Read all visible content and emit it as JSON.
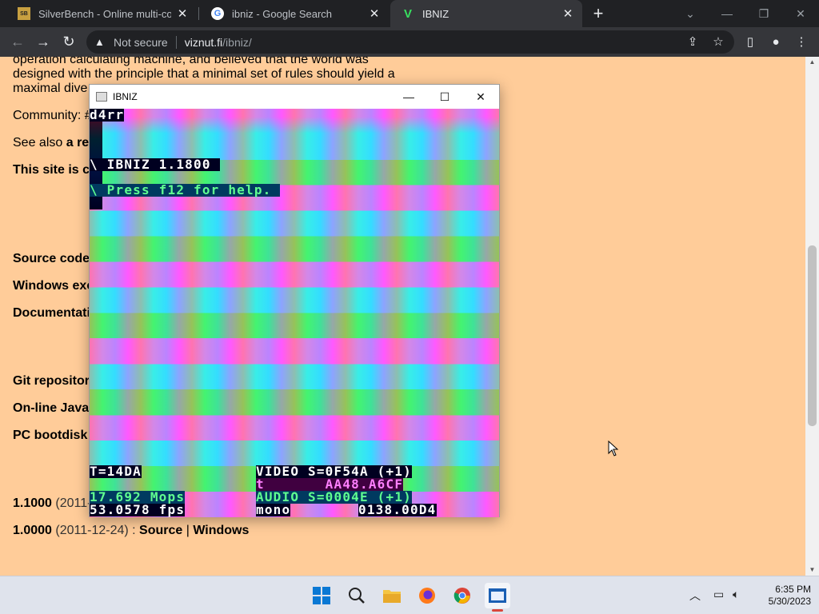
{
  "tabs": [
    {
      "title": "SilverBench - Online multi-core C",
      "favicon": "SB",
      "active": false
    },
    {
      "title": "ibniz - Google Search",
      "favicon": "G",
      "active": false
    },
    {
      "title": "IBNIZ",
      "favicon": "V",
      "active": true
    }
  ],
  "new_tab_label": "+",
  "omnibox": {
    "security_label": "Not secure",
    "url_host": "viznut.fi",
    "url_path": "/ibniz/"
  },
  "page": {
    "lines": [
      "operation calculating machine, and believed that the world was",
      "designed with the principle that a minimal set of rules should yield a",
      "maximal dive"
    ],
    "community": "Community: #",
    "see_also_prefix": "See also ",
    "see_also_bold": "a re",
    "this_site": "This site is c",
    "source_code": "Source code",
    "windows_exe": "Windows exe",
    "documentation": "Documentati",
    "git_repo": "Git repositor",
    "online_java": "On-line Java",
    "pc_bootdisk": "PC bootdisk",
    "v1_1000_ver": "1.1000",
    "v1_1000_date": " (2011-",
    "v1_0000_ver": "1.0000",
    "v1_0000_date": " (2011-12-24) : ",
    "v1_0000_source": "Source",
    "v1_0000_sep": " | ",
    "v1_0000_windows": "Windows"
  },
  "ibniz_window": {
    "title": "IBNIZ",
    "lines": {
      "prompt": "d4rr",
      "banner": "\\ IBNIZ 1.1800 ",
      "help": "\\ Press f12 for help. ",
      "t_value": "T=14DA",
      "video_line": "VIDEO S=0F54A (+1)",
      "t_line": "t       AA48.A6CF",
      "mops": "17.692 Mops",
      "audio_line": "AUDIO S=0004E (+1)",
      "fps": "53.0578 fps",
      "mono": "mono",
      "mono_value": "0138.00D4"
    }
  },
  "taskbar": {
    "time": "6:35 PM",
    "date": "5/30/2023"
  },
  "colors": {
    "page_bg": "#ffcc99",
    "chrome_dark": "#202124",
    "chrome_toolbar": "#35363a"
  }
}
